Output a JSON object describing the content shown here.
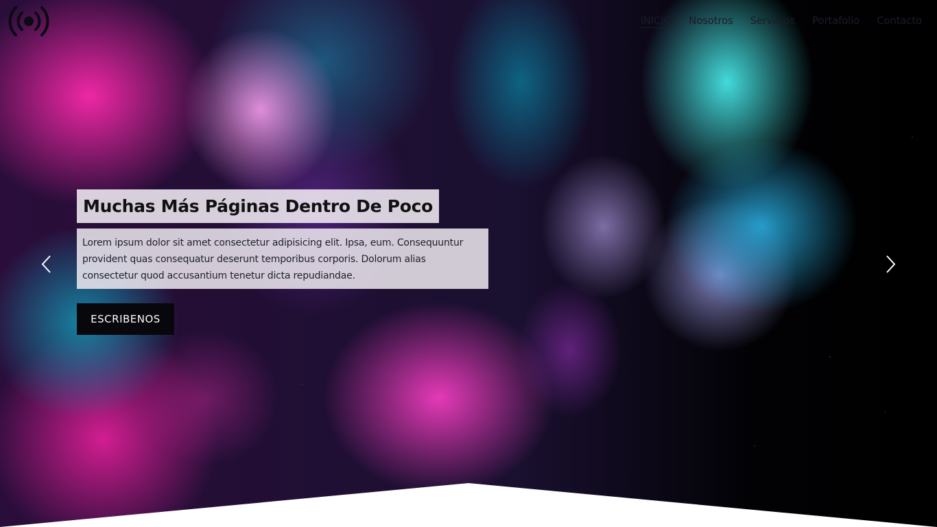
{
  "brand": {
    "logo_icon": "broadcast-icon"
  },
  "nav": {
    "items": [
      {
        "label": "INICIO",
        "active": true
      },
      {
        "label": "Nosotros",
        "active": false
      },
      {
        "label": "Servicios",
        "active": false
      },
      {
        "label": "Portafolio",
        "active": false
      },
      {
        "label": "Contacto",
        "active": false
      }
    ]
  },
  "hero": {
    "title": "Muchas Más Páginas Dentro De Poco",
    "text": "Lorem ipsum dolor sit amet consectetur adipisicing elit. Ipsa, eum. Consequuntur provident quas consequatur deserunt temporibus corporis. Dolorum alias consectetur quod accusantium tenetur dicta repudiandae.",
    "cta_label": "ESCRIBENOS",
    "prev_icon": "chevron-left-icon",
    "next_icon": "chevron-right-icon"
  },
  "colors": {
    "nav_text": "#1b1b2a",
    "button_bg": "#07070c",
    "caption_bg": "#f0ebf2"
  }
}
